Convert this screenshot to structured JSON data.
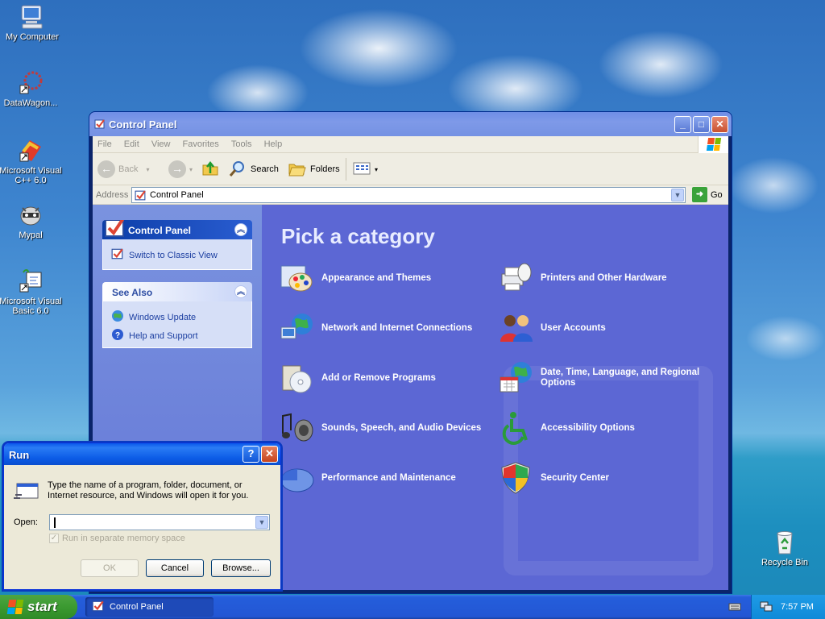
{
  "desktop": {
    "icons": [
      {
        "label": "My Computer",
        "icon": "computer-icon"
      },
      {
        "label": "DataWagon...",
        "icon": "datawagon-icon"
      },
      {
        "label": "Microsoft Visual C++ 6.0",
        "icon": "visual-cpp-icon"
      },
      {
        "label": "Mypal",
        "icon": "mypal-icon"
      },
      {
        "label": "Microsoft Visual Basic 6.0",
        "icon": "visual-basic-icon"
      },
      {
        "label": "Recycle Bin",
        "icon": "recycle-bin-icon"
      }
    ]
  },
  "window": {
    "title": "Control Panel",
    "menu": [
      "File",
      "Edit",
      "View",
      "Favorites",
      "Tools",
      "Help"
    ],
    "toolbar": {
      "back": "Back",
      "search": "Search",
      "folders": "Folders"
    },
    "address": {
      "label": "Address",
      "value": "Control Panel",
      "go": "Go"
    },
    "left_panel": {
      "control_panel": {
        "title": "Control Panel",
        "link": "Switch to Classic View"
      },
      "see_also": {
        "title": "See Also",
        "links": [
          "Windows Update",
          "Help and Support"
        ]
      }
    },
    "main": {
      "heading": "Pick a category",
      "categories": [
        {
          "label": "Appearance and Themes",
          "icon": "appearance-themes-icon"
        },
        {
          "label": "Printers and Other Hardware",
          "icon": "printer-mouse-icon"
        },
        {
          "label": "Network and Internet Connections",
          "icon": "network-globe-icon"
        },
        {
          "label": "User Accounts",
          "icon": "user-accounts-icon"
        },
        {
          "label": "Add or Remove Programs",
          "icon": "add-remove-programs-icon"
        },
        {
          "label": "Date, Time, Language, and Regional Options",
          "icon": "date-time-globe-icon"
        },
        {
          "label": "Sounds, Speech, and Audio Devices",
          "icon": "speaker-note-icon"
        },
        {
          "label": "Accessibility Options",
          "icon": "accessibility-icon"
        },
        {
          "label": "Performance and Maintenance",
          "icon": "performance-chart-icon"
        },
        {
          "label": "Security Center",
          "icon": "security-shield-icon"
        }
      ]
    }
  },
  "run_dialog": {
    "title": "Run",
    "description": "Type the name of a program, folder, document, or Internet resource, and Windows will open it for you.",
    "open_label": "Open:",
    "open_value": "",
    "checkbox_label": "Run in separate memory space",
    "checkbox_checked": true,
    "checkbox_disabled": true,
    "buttons": {
      "ok": "OK",
      "cancel": "Cancel",
      "browse": "Browse..."
    }
  },
  "taskbar": {
    "start_label": "start",
    "items": [
      {
        "label": "Control Panel"
      }
    ],
    "clock": "7:57 PM"
  },
  "colors": {
    "taskbar": "#245edb",
    "start": "#3b9a31",
    "main_pane": "#5c67d4",
    "left_pane": "#7a93df"
  }
}
